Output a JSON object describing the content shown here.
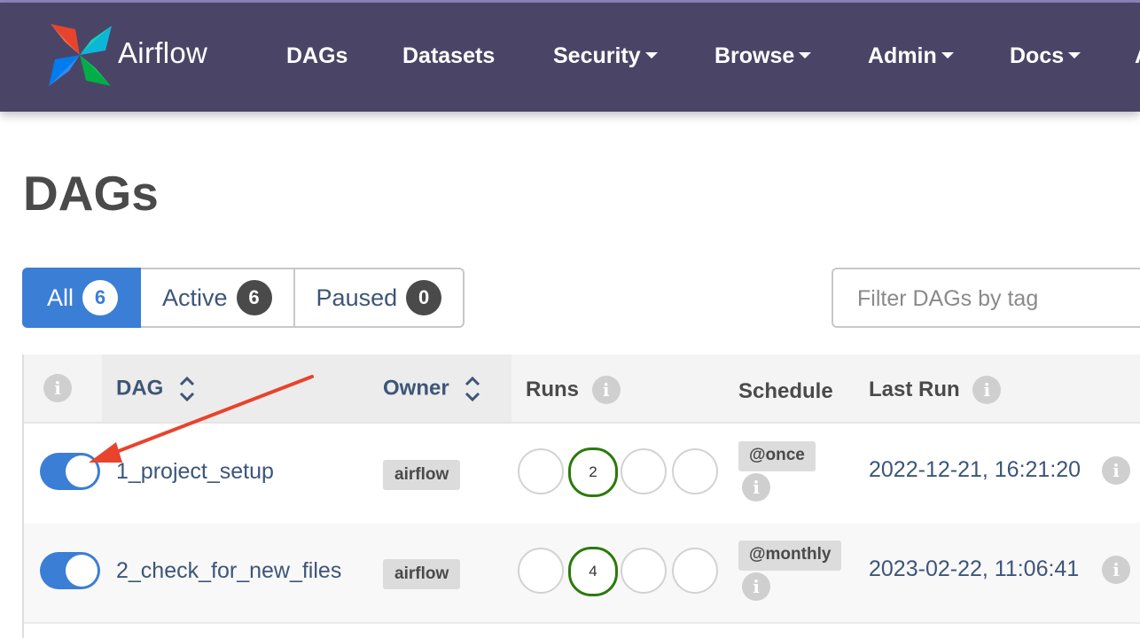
{
  "navbar": {
    "brand": "Airflow",
    "items": [
      {
        "label": "DAGs",
        "dropdown": false
      },
      {
        "label": "Datasets",
        "dropdown": false
      },
      {
        "label": "Security",
        "dropdown": true
      },
      {
        "label": "Browse",
        "dropdown": true
      },
      {
        "label": "Admin",
        "dropdown": true
      },
      {
        "label": "Docs",
        "dropdown": true
      }
    ],
    "colors": {
      "background": "#4a4566",
      "text": "#ffffff"
    }
  },
  "page": {
    "title": "DAGs"
  },
  "filters": {
    "all": {
      "label": "All",
      "count": "6",
      "selected": true
    },
    "active": {
      "label": "Active",
      "count": "6"
    },
    "paused": {
      "label": "Paused",
      "count": "0"
    },
    "tag_placeholder": "Filter DAGs by tag"
  },
  "table": {
    "headers": {
      "info": "i",
      "dag": "DAG",
      "owner": "Owner",
      "runs": "Runs",
      "schedule": "Schedule",
      "last_run": "Last Run"
    },
    "rows": [
      {
        "toggle_on": true,
        "dag_id": "1_project_setup",
        "owner": "airflow",
        "runs": [
          "",
          "2",
          "",
          ""
        ],
        "success_run_index": 1,
        "schedule": "@once",
        "last_run": "2022-12-21, 16:21:20"
      },
      {
        "toggle_on": true,
        "dag_id": "2_check_for_new_files",
        "owner": "airflow",
        "runs": [
          "",
          "4",
          "",
          ""
        ],
        "success_run_index": 1,
        "schedule": "@monthly",
        "last_run": "2023-02-22, 11:06:41"
      }
    ]
  },
  "colors": {
    "accent": "#3b7ed6",
    "link": "#3d5578",
    "success": "#2b7a0b",
    "annotation_arrow": "#e8432d"
  },
  "icons": {
    "logo": "airflow-pinwheel-icon",
    "info": "info-icon",
    "sort": "sort-icon",
    "caret": "caret-down-icon"
  }
}
